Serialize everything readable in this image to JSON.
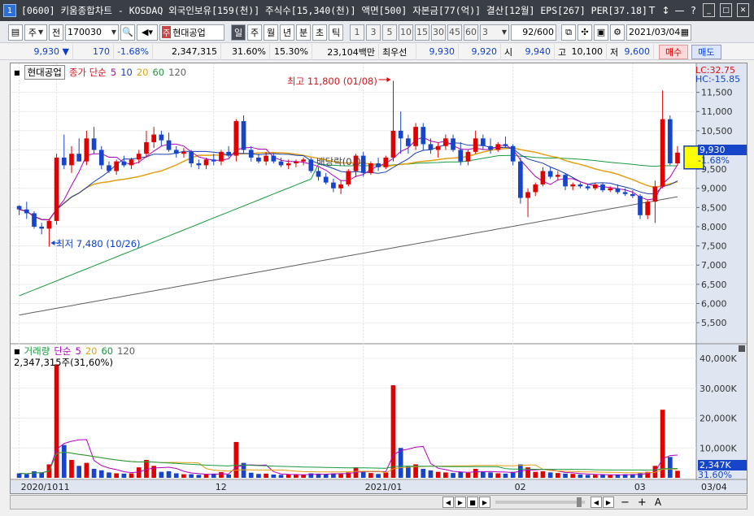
{
  "window": {
    "title": "[0600] 키움종합차트 - KOSDAQ 외국인보유[159(천)] 주식수[15,340(천)] 액면[500] 자본금[77(억)] 결산[12월] EPS[267] PER[37.18]",
    "badge": "1",
    "buttons": [
      "T",
      "↕",
      "—",
      "?",
      "_",
      "□",
      "✕"
    ]
  },
  "toolbar": {
    "mode_label": "주",
    "prev_label": "전",
    "code": "170030",
    "stock_type": "주",
    "stock_name": "현대공업",
    "periods": [
      "일",
      "주",
      "월",
      "년",
      "분",
      "초",
      "틱"
    ],
    "active_period": "일",
    "intervals": [
      "1",
      "3",
      "5",
      "10",
      "15",
      "30",
      "45",
      "60"
    ],
    "interval_value": "3",
    "count": "92/600",
    "date": "2021/03/04"
  },
  "quote": {
    "price": "9,930",
    "change": "170",
    "change_pct": "-1.68%",
    "volume": "2,347,315",
    "volume_ratio": "31.60%",
    "turnover": "15.30%",
    "amount": "23,104백만",
    "pref_label": "최우선",
    "ask": "9,930",
    "bid": "9,920",
    "open_label": "시",
    "open": "9,940",
    "high_label": "고",
    "high": "10,100",
    "low_label": "저",
    "low": "9,600",
    "buy": "매수",
    "sell": "매도"
  },
  "price_legend": {
    "name": "현대공업",
    "series_label": "종가 단순",
    "periods": [
      "5",
      "10",
      "20",
      "60",
      "120"
    ]
  },
  "volume_legend": {
    "name": "거래량",
    "series_label": "단순",
    "periods": [
      "5",
      "20",
      "60",
      "120"
    ],
    "current": "2,347,315주(31,60%)"
  },
  "annotations": {
    "high": "최고 11,800 (01/08)",
    "low": "최저 7,480 (10/26)",
    "ex_dividend": "배당락(0.0)",
    "lc": "LC:32.75",
    "hc": "HC:-15.85",
    "price_tag": "9,930",
    "pct_tag": "-1.68%",
    "vol_tag": "2,347K",
    "vol_pct_tag": "31.60%"
  },
  "colors": {
    "up": "#e00000",
    "down": "#1745c9",
    "ma5": "#b000c0",
    "ma10": "#1a3fb0",
    "ma20": "#e0a010",
    "ma60": "#1a9a40",
    "ma120": "#606060"
  },
  "chart_data": {
    "type": "candlestick",
    "price_axis": {
      "ticks": [
        5500,
        6000,
        6500,
        7000,
        7500,
        8000,
        8500,
        9000,
        9500,
        10000,
        10500,
        11000,
        11500
      ],
      "ylim": [
        5100,
        12000
      ]
    },
    "volume_axis": {
      "ticks": [
        10000,
        20000,
        30000,
        40000
      ],
      "unit": "K",
      "ylim": [
        0,
        43000
      ]
    },
    "x_labels": [
      {
        "label": "2020/10",
        "index": 0
      },
      {
        "label": "11",
        "index": 5
      },
      {
        "label": "12",
        "index": 26
      },
      {
        "label": "2021/01",
        "index": 46
      },
      {
        "label": "02",
        "index": 66
      },
      {
        "label": "03",
        "index": 82
      },
      {
        "label": "03/04",
        "index": 91
      }
    ],
    "candles": [
      [
        8540,
        8560,
        8300,
        8450,
        1500
      ],
      [
        8450,
        8650,
        8200,
        8350,
        1200
      ],
      [
        8350,
        8400,
        7950,
        8000,
        2200
      ],
      [
        8000,
        8100,
        7800,
        7950,
        1800
      ],
      [
        7950,
        8200,
        7480,
        8150,
        4500
      ],
      [
        8150,
        9900,
        8050,
        9800,
        38000
      ],
      [
        9800,
        10400,
        9500,
        9600,
        11000
      ],
      [
        9600,
        10100,
        9400,
        9900,
        6000
      ],
      [
        9900,
        10300,
        9700,
        9700,
        4000
      ],
      [
        9700,
        10500,
        9600,
        10300,
        5000
      ],
      [
        10300,
        10600,
        9900,
        10000,
        3000
      ],
      [
        10000,
        10100,
        9500,
        9600,
        2500
      ],
      [
        9600,
        9700,
        9400,
        9450,
        1800
      ],
      [
        9450,
        9750,
        9350,
        9700,
        1500
      ],
      [
        9700,
        9850,
        9550,
        9600,
        1400
      ],
      [
        9600,
        9800,
        9500,
        9750,
        1500
      ],
      [
        9750,
        10000,
        9650,
        9900,
        3500
      ],
      [
        9900,
        10500,
        9800,
        10200,
        6000
      ],
      [
        10200,
        10600,
        10050,
        10400,
        4000
      ],
      [
        10400,
        10500,
        10100,
        10250,
        2000
      ],
      [
        10250,
        10450,
        9950,
        10000,
        2200
      ],
      [
        10000,
        10100,
        9800,
        9900,
        1500
      ],
      [
        9900,
        10050,
        9800,
        9950,
        1200
      ],
      [
        9950,
        10000,
        9550,
        9650,
        1200
      ],
      [
        9650,
        9750,
        9500,
        9600,
        1000
      ],
      [
        9600,
        9800,
        9500,
        9750,
        1100
      ],
      [
        9750,
        9900,
        9600,
        9700,
        1400
      ],
      [
        9700,
        10000,
        9600,
        9950,
        1900
      ],
      [
        9950,
        10100,
        9800,
        9850,
        1100
      ],
      [
        9850,
        10800,
        9700,
        10750,
        12000
      ],
      [
        10750,
        10900,
        9900,
        10000,
        5000
      ],
      [
        10000,
        10100,
        9700,
        9800,
        1700
      ],
      [
        9800,
        9900,
        9650,
        9700,
        1300
      ],
      [
        9700,
        9950,
        9600,
        9850,
        1400
      ],
      [
        9850,
        9900,
        9650,
        9700,
        1100
      ],
      [
        9700,
        9800,
        9550,
        9600,
        1000
      ],
      [
        9600,
        9750,
        9500,
        9650,
        1100
      ],
      [
        9650,
        9750,
        9550,
        9700,
        1000
      ],
      [
        9700,
        9800,
        9600,
        9750,
        1000
      ],
      [
        9750,
        9800,
        9400,
        9450,
        1500
      ],
      [
        9450,
        9550,
        9200,
        9300,
        1400
      ],
      [
        9300,
        9400,
        9100,
        9150,
        1200
      ],
      [
        9150,
        9250,
        8900,
        9000,
        1500
      ],
      [
        9000,
        9200,
        8850,
        9100,
        1300
      ],
      [
        9100,
        9500,
        9050,
        9450,
        1800
      ],
      [
        9450,
        9900,
        9300,
        9850,
        3500
      ],
      [
        9850,
        9950,
        9300,
        9400,
        2200
      ],
      [
        9400,
        9700,
        9350,
        9650,
        1600
      ],
      [
        9650,
        9800,
        9450,
        9550,
        1300
      ],
      [
        9550,
        9850,
        9500,
        9800,
        1800
      ],
      [
        9800,
        11800,
        9700,
        10500,
        31000
      ],
      [
        10500,
        11000,
        9900,
        10300,
        10000
      ],
      [
        10300,
        10400,
        9900,
        10100,
        4000
      ],
      [
        10100,
        10700,
        10000,
        10600,
        4500
      ],
      [
        10600,
        10700,
        10000,
        10150,
        3000
      ],
      [
        10150,
        10300,
        9900,
        10000,
        2500
      ],
      [
        10000,
        10200,
        9800,
        10100,
        2000
      ],
      [
        10100,
        10400,
        10000,
        10300,
        1800
      ],
      [
        10300,
        10400,
        9950,
        10000,
        1600
      ],
      [
        10000,
        10200,
        9600,
        9700,
        2000
      ],
      [
        9700,
        10000,
        9600,
        9950,
        1700
      ],
      [
        9950,
        10500,
        9900,
        10300,
        3000
      ],
      [
        10300,
        10400,
        10000,
        10100,
        2000
      ],
      [
        10100,
        10300,
        9900,
        10000,
        1800
      ],
      [
        10000,
        10200,
        9950,
        10150,
        1500
      ],
      [
        10150,
        10350,
        10050,
        10100,
        1400
      ],
      [
        10100,
        10150,
        9600,
        9700,
        2000
      ],
      [
        9700,
        9800,
        8600,
        8750,
        4500
      ],
      [
        8750,
        9000,
        8250,
        8900,
        3500
      ],
      [
        8900,
        9150,
        8800,
        9100,
        2000
      ],
      [
        9100,
        9550,
        9050,
        9450,
        2200
      ],
      [
        9450,
        9550,
        9250,
        9300,
        1800
      ],
      [
        9300,
        9450,
        9200,
        9350,
        1600
      ],
      [
        9350,
        9400,
        8950,
        9050,
        1400
      ],
      [
        9050,
        9150,
        8950,
        9100,
        1300
      ],
      [
        9100,
        9150,
        9000,
        9050,
        1100
      ],
      [
        9050,
        9100,
        8950,
        9000,
        1000
      ],
      [
        9000,
        9150,
        8950,
        9100,
        1000
      ],
      [
        9100,
        9150,
        8900,
        8950,
        1000
      ],
      [
        8950,
        9050,
        8900,
        9000,
        900
      ],
      [
        9000,
        9100,
        8850,
        8900,
        1100
      ],
      [
        8900,
        9000,
        8800,
        8850,
        1200
      ],
      [
        8850,
        8950,
        8750,
        8800,
        1200
      ],
      [
        8800,
        8850,
        8200,
        8300,
        1500
      ],
      [
        8300,
        8700,
        8200,
        8650,
        2000
      ],
      [
        8650,
        9200,
        8100,
        9050,
        4000
      ],
      [
        9050,
        11550,
        9000,
        10800,
        22800
      ],
      [
        10800,
        10900,
        9600,
        9650,
        7000
      ],
      [
        9650,
        10100,
        9600,
        9930,
        2347
      ]
    ]
  }
}
